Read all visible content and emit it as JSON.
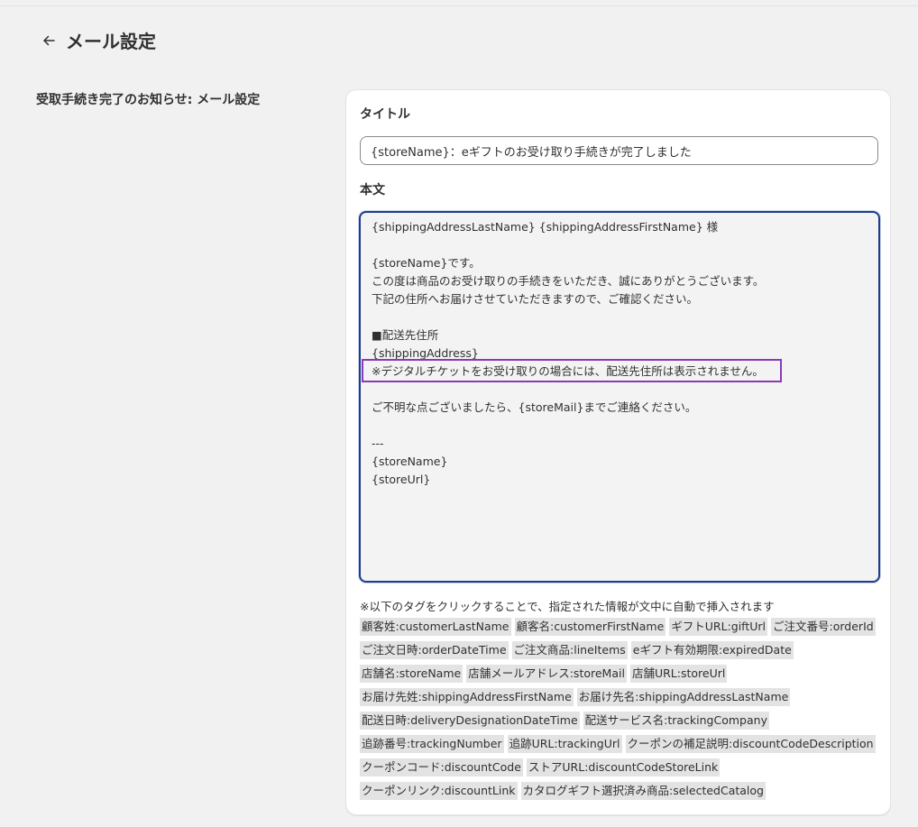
{
  "header": {
    "title": "メール設定"
  },
  "section": {
    "label": "受取手続き完了のお知らせ: メール設定"
  },
  "form": {
    "title_label": "タイトル",
    "title_value": "{storeName}：eギフトのお受け取り手続きが完了しました",
    "body_label": "本文",
    "body_lines": [
      "{shippingAddressLastName} {shippingAddressFirstName} 様",
      "",
      "{storeName}です。",
      "この度は商品のお受け取りの手続きをいただき、誠にありがとうございます。",
      "下記の住所へお届けさせていただきますので、ご確認ください。",
      "",
      "■配送先住所",
      "{shippingAddress}",
      "※デジタルチケットをお受け取りの場合には、配送先住所は表示されません。",
      "",
      "ご不明な点ございましたら、{storeMail}までご連絡ください。",
      "",
      "---",
      "{storeName}",
      "{storeUrl}"
    ],
    "hint": "※以下のタグをクリックすることで、指定された情報が文中に自動で挿入されます",
    "tag_rows": [
      [
        "顧客姓:customerLastName",
        "顧客名:customerFirstName",
        "ギフトURL:giftUrl",
        "ご注文番号:orderId"
      ],
      [
        "ご注文日時:orderDateTime",
        "ご注文商品:lineItems",
        "eギフト有効期限:expiredDate"
      ],
      [
        "店舗名:storeName",
        "店舗メールアドレス:storeMail",
        "店舗URL:storeUrl"
      ],
      [
        "お届け先姓:shippingAddressFirstName",
        "お届け先名:shippingAddressLastName"
      ],
      [
        "配送日時:deliveryDesignationDateTime",
        "配送サービス名:trackingCompany"
      ],
      [
        "追跡番号:trackingNumber",
        "追跡URL:trackingUrl",
        "クーポンの補足説明:discountCodeDescription"
      ],
      [
        "クーポンコード:discountCode",
        "ストアURL:discountCodeStoreLink"
      ],
      [
        "クーポンリンク:discountLink",
        "カタログギフト選択済み商品:selectedCatalog"
      ]
    ]
  },
  "colors": {
    "accent_focus": "#1f3d8c",
    "highlight": "#8a3ab9",
    "tag_bg": "#e3e3e3"
  },
  "icons": {
    "back": "arrow-left-icon"
  }
}
